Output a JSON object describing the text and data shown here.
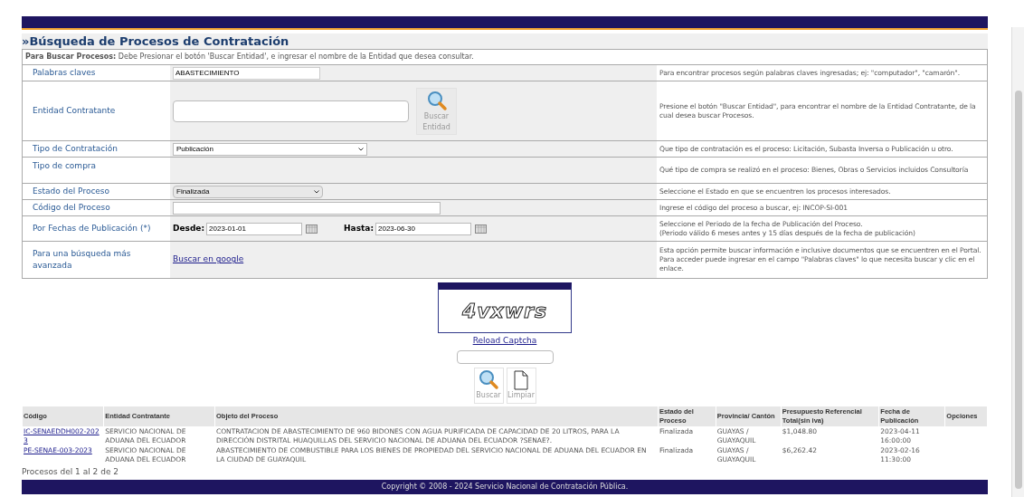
{
  "title": "»Búsqueda de Procesos de Contratación",
  "instruction": "**Para Buscar Procesos:** Debe Presionar el botón 'Buscar Entidad', e ingresar el nombre de la Entidad que desea consultar.",
  "form_rows": [
    {
      "kind": "text",
      "label": "Palabras claves",
      "value": "ABASTECIMIENTO",
      "help": "Para encontrar procesos según palabras claves ingresadas; ej: \"computador\", \"camarón\"."
    },
    {
      "kind": "textarea",
      "label": "Entidad Contratante",
      "button": "Buscar Entidad",
      "help": "Presione el botón \"Buscar Entidad\", para encontrar el nombre de la Entidad Contratante, de la cual desea buscar Procesos."
    },
    {
      "kind": "select",
      "label": "Tipo de Contratación",
      "value": "Publicación",
      "help": "Que tipo de contratación es el proceso: Licitación, Subasta Inversa o Publicación u otro."
    },
    {
      "kind": "empty",
      "label": "Tipo de compra",
      "help": "Qué tipo de compra se realizó en el proceso: Bienes, Obras o Servicios incluidos Consultoría"
    },
    {
      "kind": "select-short",
      "label": "Estado del Proceso",
      "value": "Finalizada",
      "help": "Seleccione el Estado en que se encuentren los procesos interesados."
    },
    {
      "kind": "code",
      "label": "Código del Proceso",
      "help": "Ingrese el código del proceso a buscar, ej: INCOP-SI-001"
    },
    {
      "kind": "dates",
      "label": "Por Fechas de Publicación (*)",
      "from_label": "Desde:",
      "from": "2023-01-01",
      "to_label": "Hasta:",
      "to": "2023-06-30",
      "help": "Seleccione el Periodo de la fecha de Publicación del Proceso.\n(Periodo válido 6 meses antes y 15 días después de la fecha de publicación)"
    },
    {
      "kind": "link",
      "label": "Para una búsqueda más avanzada",
      "link": "Buscar en google",
      "help": "Esta opción permite buscar información e inclusive documentos que se encuentren en el Portal. Para acceder puede ingresar en el campo \"Palabras claves\" lo que necesita buscar y clic en el enlace."
    }
  ],
  "captcha": {
    "text": "4vxwrs",
    "reload": "Reload Captcha"
  },
  "actions": [
    {
      "kind": "search",
      "label": "Buscar"
    },
    {
      "kind": "clear",
      "label": "Limpiar"
    }
  ],
  "table": {
    "columns": [
      "Código",
      "Entidad Contratante",
      "Objeto del Proceso",
      "Estado del Proceso",
      "Provincia/ Cantón",
      "Presupuesto Referencial Total(sin iva)",
      "Fecha de Publicación",
      "Opciones"
    ],
    "rows": [
      [
        "IC-SENAEDDH002-2023",
        "SERVICIO NACIONAL DE ADUANA DEL ECUADOR",
        "CONTRATACION DE ABASTECIMIENTO DE 960 BIDONES CON AGUA PURIFICADA DE CAPACIDAD DE 20 LITROS, PARA LA DIRECCIÓN DISTRITAL HUAQUILLAS DEL SERVICIO NACIONAL DE ADUANA DEL ECUADOR ?SENAE?.",
        "Finalizada",
        "GUAYAS / GUAYAQUIL",
        "$1,048.80",
        "2023-04-11 16:00:00"
      ],
      [
        "PE-SENAE-003-2023",
        "SERVICIO NACIONAL DE ADUANA DEL ECUADOR",
        "ABASTECIMIENTO DE COMBUSTIBLE PARA LOS BIENES DE PROPIEDAD DEL SERVICIO NACIONAL DE ADUANA DEL ECUADOR EN LA CIUDAD DE GUAYAQUIL",
        "Finalizada",
        "GUAYAS / GUAYAQUIL",
        "$6,262.42",
        "2023-02-16 11:30:00"
      ]
    ]
  },
  "pagination": "Procesos del 1 al 2 de 2",
  "footer": "Copyright © 2008 - 2024 Servicio Nacional de Contratación Pública."
}
